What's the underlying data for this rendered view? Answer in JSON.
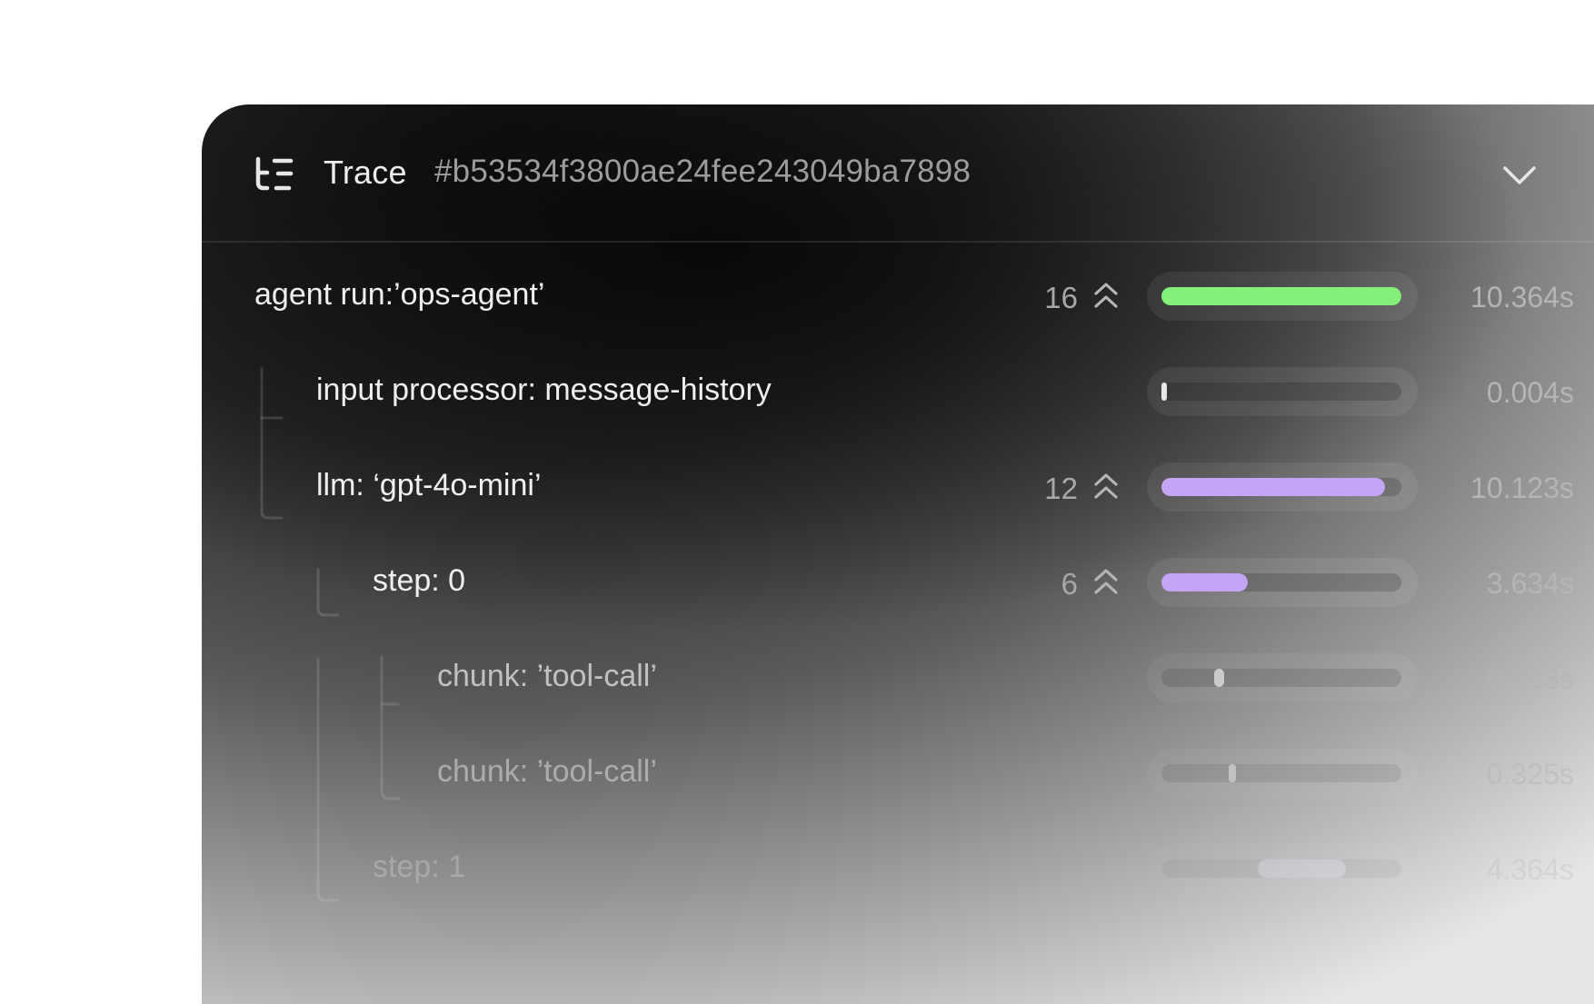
{
  "header": {
    "title": "Trace",
    "trace_id": "#b53534f3800ae24fee243049ba7898",
    "icon": "trace-tree-icon",
    "collapse_icon": "chevron-down-icon"
  },
  "colors": {
    "agent_run_bar": "#84f07a",
    "llm_bar": "#c4a4f5",
    "step_bar": "#c4a4f5",
    "chunk_marker": "#e8e8e8",
    "step1_bar": "#ecdffa"
  },
  "spans": [
    {
      "label": "agent run:’ops-agent’",
      "count": "16",
      "duration": "10.364s",
      "bar_start": 0.0,
      "bar_end": 1.0
    },
    {
      "label": "input processor: message-history",
      "count": "",
      "duration": "0.004s",
      "bar_start": 0.0,
      "bar_end": 0.01
    },
    {
      "label": "llm: ‘gpt-4o-mini’",
      "count": "12",
      "duration": "10.123s",
      "bar_start": 0.0,
      "bar_end": 0.93
    },
    {
      "label": "step: 0",
      "count": "6",
      "duration": "3.634s",
      "bar_start": 0.0,
      "bar_end": 0.36
    },
    {
      "label": "chunk: ’tool-call’",
      "count": "",
      "duration": "0.423s",
      "bar_start": 0.22,
      "bar_end": 0.26
    },
    {
      "label": "chunk: ’tool-call’",
      "count": "",
      "duration": "0.325s",
      "bar_start": 0.28,
      "bar_end": 0.31
    },
    {
      "label": "step: 1",
      "count": "",
      "duration": "4.364s",
      "bar_start": 0.4,
      "bar_end": 0.77
    }
  ]
}
